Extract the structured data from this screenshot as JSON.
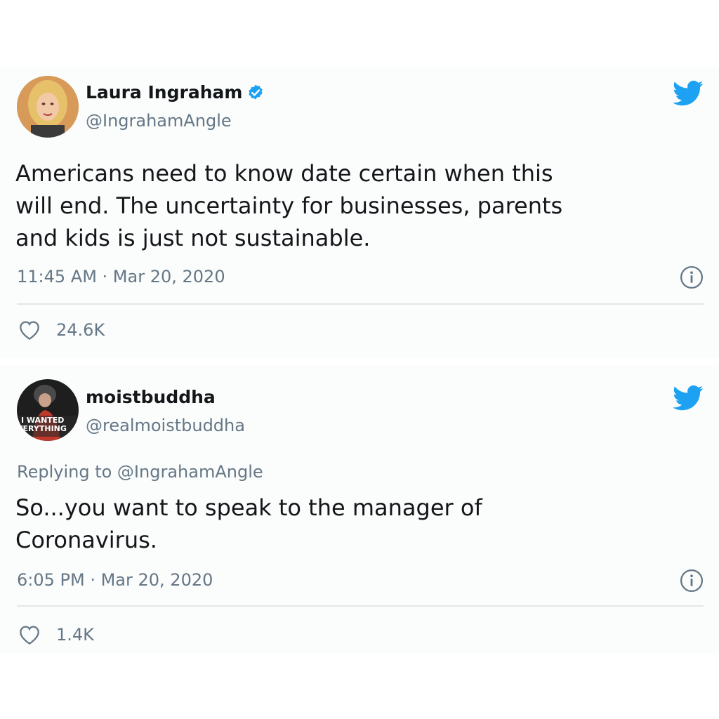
{
  "tweets": [
    {
      "display_name": "Laura Ingraham",
      "verified": true,
      "handle": "@IngrahamAngle",
      "text": "Americans need to know date certain when this\nwill end.  The uncertainty for businesses, parents\nand kids is just not sustainable.",
      "timestamp": "11:45 AM · Mar 20, 2020",
      "likes": "24.6K"
    },
    {
      "display_name": "moistbuddha",
      "verified": false,
      "handle": "@realmoistbuddha",
      "avatar_text": [
        "I WANTED",
        "VERYTHING"
      ],
      "reply_to": "Replying to @IngrahamAngle",
      "text": "So...you want to speak to the manager of\nCoronavirus.",
      "timestamp": "6:05 PM · Mar 20, 2020",
      "likes": "1.4K"
    }
  ],
  "colors": {
    "text": "#14171a",
    "secondary": "#657786",
    "twitter_blue": "#1da1f2",
    "divider": "#e3e6e8"
  },
  "icons": [
    "verified-badge-icon",
    "twitter-bird-icon",
    "info-icon",
    "heart-icon"
  ]
}
